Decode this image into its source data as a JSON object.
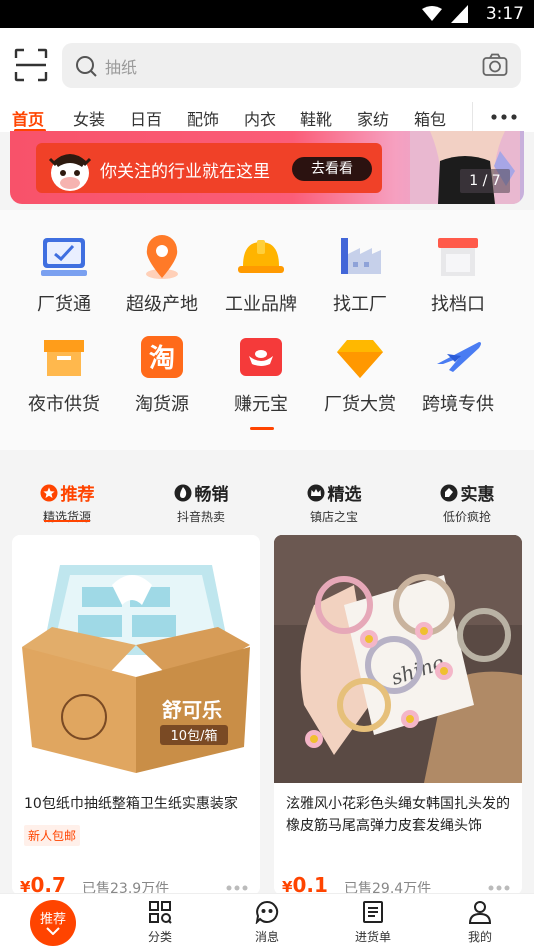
{
  "status_bar": {
    "time": "3:17"
  },
  "search": {
    "placeholder": "抽纸"
  },
  "category_tabs": [
    {
      "label": "首页",
      "active": true
    },
    {
      "label": "女装"
    },
    {
      "label": "日百"
    },
    {
      "label": "配饰"
    },
    {
      "label": "内衣"
    },
    {
      "label": "鞋靴"
    },
    {
      "label": "家纺"
    },
    {
      "label": "箱包"
    }
  ],
  "banner": {
    "text": "你关注的行业就在这里",
    "button": "去看看",
    "counter": "1 / 7"
  },
  "grid_items": [
    {
      "label": "厂货通",
      "icon": "factory-goods-icon"
    },
    {
      "label": "超级产地",
      "icon": "location-pin-icon"
    },
    {
      "label": "工业品牌",
      "icon": "hard-hat-icon"
    },
    {
      "label": "找工厂",
      "icon": "factory-icon"
    },
    {
      "label": "找档口",
      "icon": "storefront-icon"
    },
    {
      "label": "夜市供货",
      "icon": "box-icon"
    },
    {
      "label": "淘货源",
      "icon": "tao-icon"
    },
    {
      "label": "赚元宝",
      "icon": "ingot-icon"
    },
    {
      "label": "厂货大赏",
      "icon": "diamond-icon"
    },
    {
      "label": "跨境专供",
      "icon": "airplane-icon"
    }
  ],
  "feed_tabs": [
    {
      "title": "推荐",
      "subtitle": "精选货源",
      "active": true
    },
    {
      "title": "畅销",
      "subtitle": "抖音热卖"
    },
    {
      "title": "精选",
      "subtitle": "镇店之宝"
    },
    {
      "title": "实惠",
      "subtitle": "低价疯抢"
    }
  ],
  "products": [
    {
      "title": "10包纸巾抽纸整箱卫生纸实惠装家",
      "tag": "新人包邮",
      "currency": "¥",
      "price": "0.7",
      "sold": "已售23.9万件",
      "box_brand": "舒可乐",
      "box_label": "10包/箱"
    },
    {
      "title": "泫雅风小花彩色头绳女韩国扎头发的橡皮筋马尾高弹力皮套发绳头饰",
      "currency": "¥",
      "price": "0.1",
      "sold": "已售29.4万件",
      "card_text": "shine"
    }
  ],
  "bottom_nav": [
    {
      "label": "推荐",
      "active": true
    },
    {
      "label": "分类"
    },
    {
      "label": "消息"
    },
    {
      "label": "进货单"
    },
    {
      "label": "我的"
    }
  ],
  "colors": {
    "accent": "#ff4400",
    "banner": "#f8526a"
  }
}
